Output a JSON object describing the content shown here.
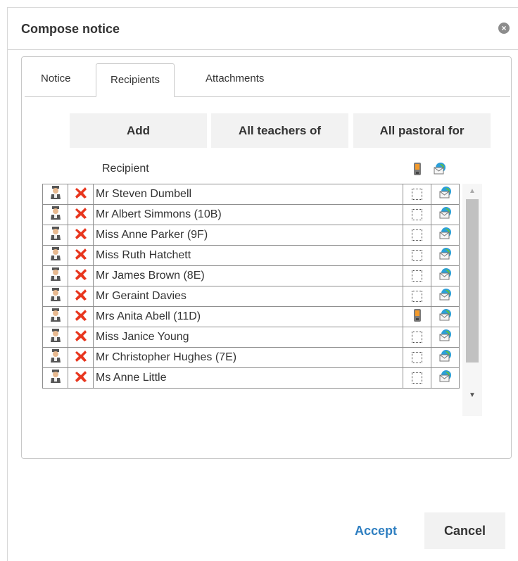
{
  "dialog": {
    "title": "Compose notice",
    "close_icon": "close-icon"
  },
  "tabs": [
    {
      "label": "Notice",
      "active": false
    },
    {
      "label": "Recipients",
      "active": true
    },
    {
      "label": "Attachments",
      "active": false
    }
  ],
  "actions": {
    "add": "Add",
    "all_teachers": "All teachers of",
    "all_pastoral": "All pastoral for"
  },
  "grid": {
    "column_header": "Recipient",
    "phone_header_icon": "mobile-phone-icon",
    "email_header_icon": "email-icon",
    "rows": [
      {
        "name": "Mr Steven Dumbell",
        "phone": "checkbox",
        "email": true
      },
      {
        "name": "Mr Albert Simmons (10B)",
        "phone": "checkbox",
        "email": true
      },
      {
        "name": "Miss Anne Parker (9F)",
        "phone": "checkbox",
        "email": true
      },
      {
        "name": "Miss Ruth Hatchett",
        "phone": "checkbox",
        "email": true
      },
      {
        "name": "Mr James Brown (8E)",
        "phone": "checkbox",
        "email": true
      },
      {
        "name": "Mr Geraint Davies",
        "phone": "checkbox",
        "email": true
      },
      {
        "name": "Mrs Anita Abell (11D)",
        "phone": "mobile",
        "email": true
      },
      {
        "name": "Miss Janice Young",
        "phone": "checkbox",
        "email": true
      },
      {
        "name": "Mr Christopher Hughes (7E)",
        "phone": "checkbox",
        "email": true
      },
      {
        "name": "Ms Anne Little",
        "phone": "checkbox",
        "email": true
      }
    ]
  },
  "footer": {
    "accept": "Accept",
    "cancel": "Cancel"
  },
  "colors": {
    "accept_text": "#2f7fc1",
    "delete_x": "#e8361e",
    "button_bg": "#f2f2f2"
  }
}
